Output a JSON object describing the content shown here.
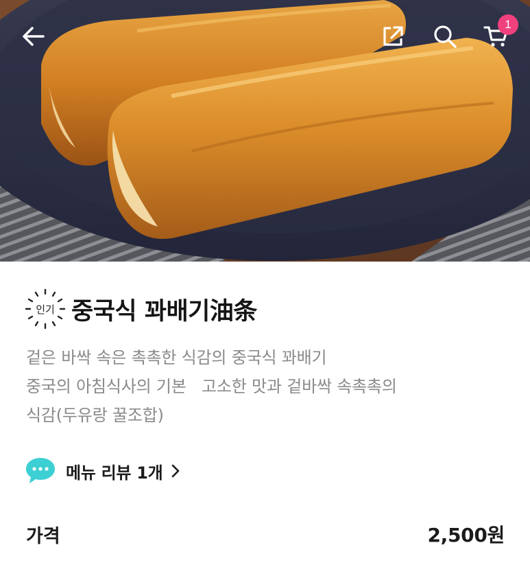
{
  "header": {
    "icons": {
      "back": "arrow-left-icon",
      "share": "share-icon",
      "search": "search-icon",
      "cart": "cart-icon"
    },
    "cart_count": "1"
  },
  "product": {
    "badge": "인기",
    "title": "중국식 꽈배기油条",
    "description_lines": [
      "겉은 바싹 속은 촉촉한 식감의 중국식 꽈배기",
      "중국의 아침식사의 기본   고소한 맛과 겉바싹 속촉촉의",
      "식감(두유랑 꿀조합)"
    ]
  },
  "review": {
    "label": "메뉴 리뷰 1개",
    "icon": "chat-bubble-icon"
  },
  "price": {
    "label": "가격",
    "value": "2,500원"
  },
  "colors": {
    "badge": "#f0417e",
    "review_icon": "#3ccfd3",
    "plate": "#2e3142",
    "pastry": "#d98c2c"
  }
}
